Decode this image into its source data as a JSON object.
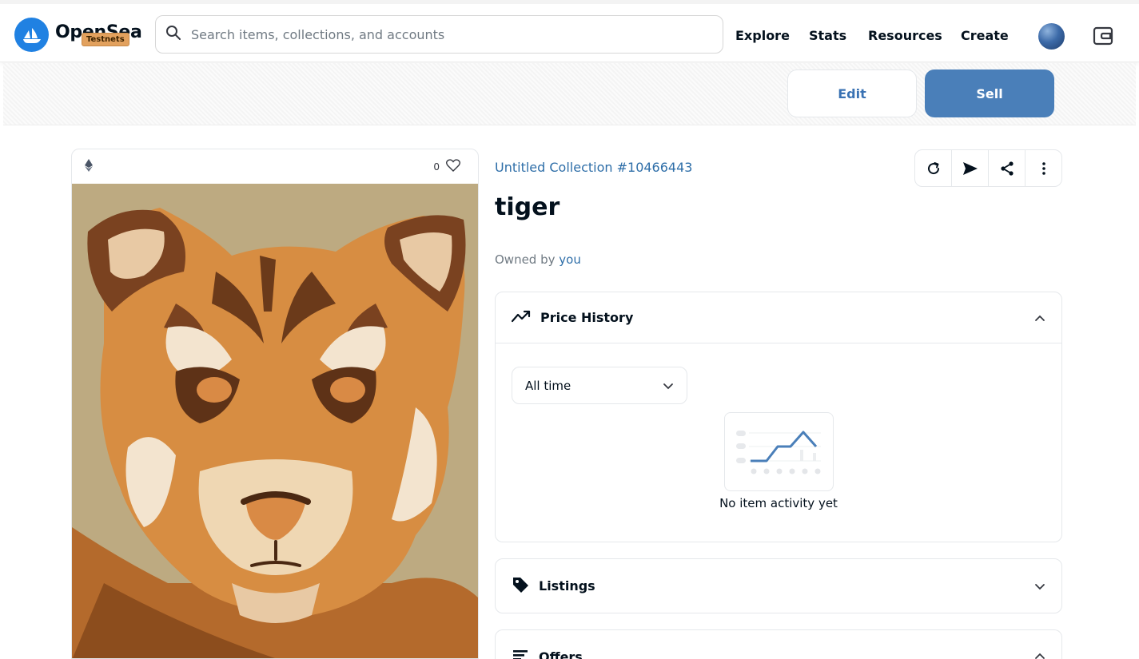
{
  "brand": {
    "name": "OpenSea",
    "badge": "Testnets",
    "colors": {
      "logo": "#2081e2",
      "sell_button": "#4a7fb9",
      "badge": "#e2a15e"
    }
  },
  "search": {
    "placeholder": "Search items, collections, and accounts",
    "icon": "search-icon"
  },
  "nav": {
    "items": [
      "Explore",
      "Stats",
      "Resources",
      "Create"
    ]
  },
  "actions": {
    "edit_label": "Edit",
    "sell_label": "Sell"
  },
  "image_card": {
    "chain_icon": "ethereum-icon",
    "favorites_count": "0",
    "favorite_icon": "heart-icon"
  },
  "item": {
    "collection": "Untitled Collection #10466443",
    "name": "tiger",
    "owner_prefix": "Owned by",
    "owner": "you"
  },
  "toolbar_icons": [
    "refresh-icon",
    "send-icon",
    "share-icon",
    "more-icon"
  ],
  "price_history": {
    "title": "Price History",
    "range": "All time",
    "empty_text": "No item activity yet"
  },
  "listings": {
    "title": "Listings"
  },
  "offers": {
    "title": "Offers"
  }
}
